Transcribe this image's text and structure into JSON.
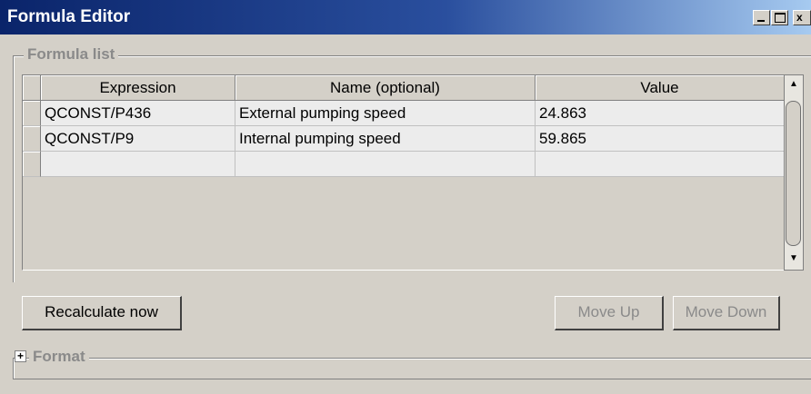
{
  "window": {
    "title": "Formula Editor",
    "controls": {
      "minimize": "_",
      "maximize": "□",
      "close": "x"
    }
  },
  "formula_list": {
    "label": "Formula list",
    "columns": [
      "Expression",
      "Name (optional)",
      "Value"
    ],
    "rows": [
      {
        "expression": "QCONST/P436",
        "name": "External pumping speed",
        "value": "24.863"
      },
      {
        "expression": "QCONST/P9",
        "name": "Internal pumping speed",
        "value": "59.865"
      },
      {
        "expression": "",
        "name": "",
        "value": ""
      }
    ]
  },
  "buttons": {
    "recalculate": "Recalculate now",
    "move_up": "Move Up",
    "move_down": "Move Down"
  },
  "format": {
    "label": "Format",
    "expander": "+"
  },
  "scrollbar": {
    "up": "▲",
    "down": "▼"
  }
}
